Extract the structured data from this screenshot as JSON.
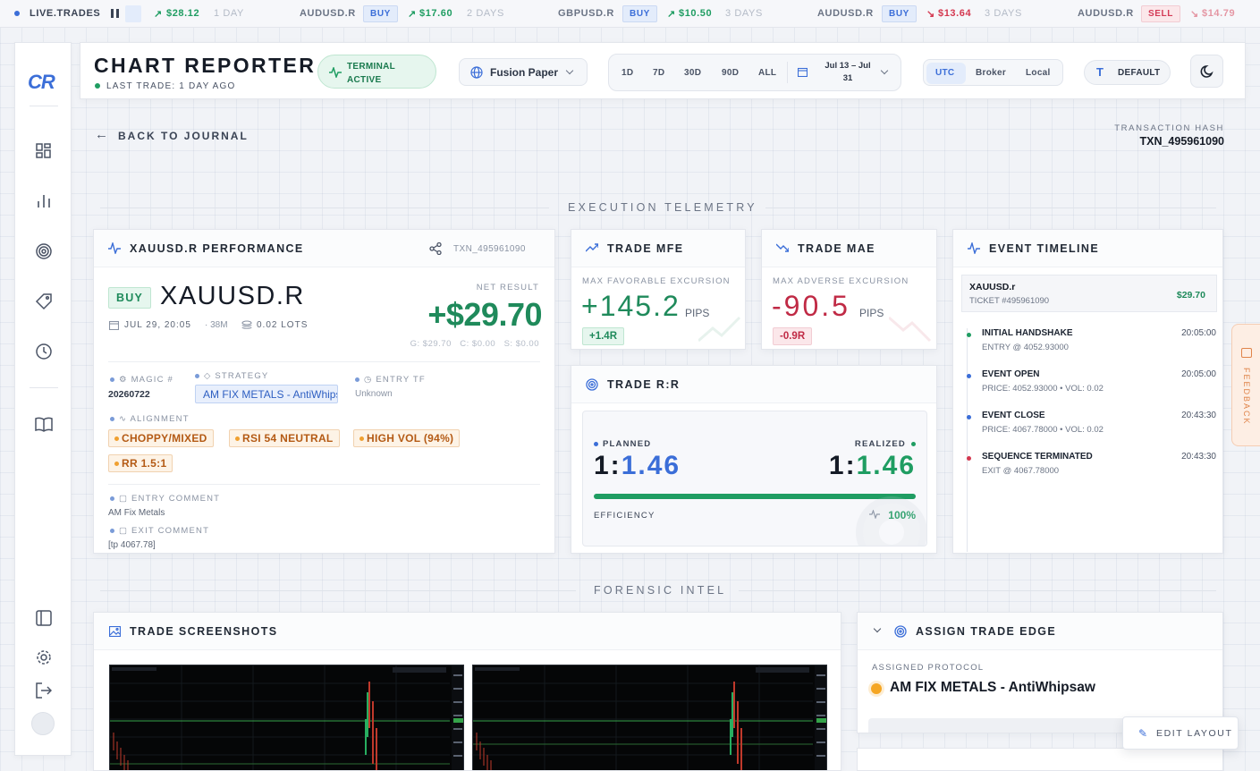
{
  "ticker": {
    "live_label": "LIVE.TRADES",
    "items": [
      {
        "value": "$28.12",
        "age": "1 DAY"
      },
      {
        "pair": "AUDUSD.R",
        "side": "BUY",
        "value": "$17.60",
        "age": "2 DAYS"
      },
      {
        "pair": "GBPUSD.R",
        "side": "BUY",
        "value": "$10.50",
        "age": "3 DAYS"
      },
      {
        "pair": "AUDUSD.R",
        "side": "BUY",
        "value": "$13.64",
        "age": "3 DAYS"
      },
      {
        "pair": "AUDUSD.R",
        "side": "SELL",
        "value": "$14.79"
      }
    ]
  },
  "sidebar": {
    "logo": "CR"
  },
  "header": {
    "title": "CHART REPORTER",
    "last_trade": "LAST TRADE: 1 DAY AGO",
    "terminal_status": "TERMINAL ACTIVE",
    "account": "Fusion Paper",
    "ranges": [
      "1D",
      "7D",
      "30D",
      "90D",
      "ALL"
    ],
    "date_range": "Jul 13 – Jul 31",
    "timezones": [
      "UTC",
      "Broker",
      "Local"
    ],
    "font_preset": "DEFAULT"
  },
  "nav": {
    "back": "BACK TO JOURNAL",
    "hash_label": "TRANSACTION HASH",
    "hash_value": "TXN_495961090"
  },
  "sections": {
    "telemetry": "EXECUTION TELEMETRY",
    "forensic": "FORENSIC INTEL"
  },
  "performance": {
    "title": "XAUUSD.R PERFORMANCE",
    "txn": "TXN_495961090",
    "side": "BUY",
    "symbol": "XAUUSD.R",
    "date": "JUL 29, 20:05",
    "duration": "· 38M",
    "lots": "0.02 LOTS",
    "net_label": "NET RESULT",
    "net_value": "+$29.70",
    "breakdown": "G: $29.70   C: $0.00   S: $0.00",
    "magic_label": "MAGIC #",
    "magic_value": "20260722",
    "strategy_label": "STRATEGY",
    "strategy_value": "AM FIX METALS - AntiWhipsaw",
    "entry_tf_label": "ENTRY TF",
    "entry_tf_value": "Unknown",
    "alignment_label": "ALIGNMENT",
    "alignment_tags": [
      "CHOPPY/MIXED",
      "RSI 54 NEUTRAL",
      "HIGH VOL (94%)",
      "RR 1.5:1"
    ],
    "entry_comment_label": "ENTRY COMMENT",
    "entry_comment": "AM Fix Metals",
    "exit_comment_label": "EXIT COMMENT",
    "exit_comment": "[tp 4067.78]"
  },
  "mfe": {
    "title": "TRADE MFE",
    "label": "MAX FAVORABLE EXCURSION",
    "value": "+145.2",
    "unit": "PIPS",
    "r": "+1.4R",
    "color": "#1f8a5b"
  },
  "mae": {
    "title": "TRADE MAE",
    "label": "MAX ADVERSE EXCURSION",
    "value": "-90.5",
    "unit": "PIPS",
    "r": "-0.9R",
    "color": "#c02a45"
  },
  "rr": {
    "title": "TRADE R:R",
    "planned_label": "PLANNED",
    "planned_prefix": "1:",
    "planned_value": "1.46",
    "realized_label": "REALIZED",
    "realized_prefix": "1:",
    "realized_value": "1.46",
    "efficiency_label": "EFFICIENCY",
    "efficiency_value": "100%",
    "efficiency_fraction": 1.0
  },
  "timeline": {
    "title": "EVENT TIMELINE",
    "symbol": "XAUUSD.r",
    "ticket": "TICKET #495961090",
    "pnl": "$29.70",
    "events": [
      {
        "title": "INITIAL HANDSHAKE",
        "sub": "ENTRY @ 4052.93000",
        "time": "20:05:00",
        "color": "#1f9d62"
      },
      {
        "title": "EVENT OPEN",
        "sub": "PRICE: 4052.93000 • VOL: 0.02",
        "time": "20:05:00",
        "color": "#3b6ed8"
      },
      {
        "title": "EVENT CLOSE",
        "sub": "PRICE: 4067.78000 • VOL: 0.02",
        "time": "20:43:30",
        "color": "#3b6ed8"
      },
      {
        "title": "SEQUENCE TERMINATED",
        "sub": "EXIT @ 4067.78000",
        "time": "20:43:30",
        "color": "#d4374f"
      }
    ]
  },
  "screenshots": {
    "title": "TRADE SCREENSHOTS"
  },
  "edge": {
    "title": "ASSIGN TRADE EDGE",
    "protocol_label": "ASSIGNED PROTOCOL",
    "protocol": "AM FIX METALS - AntiWhipsaw",
    "protocol_color": "#f5a623"
  },
  "feedback": "FEEDBACK",
  "edit_layout": "EDIT LAYOUT"
}
